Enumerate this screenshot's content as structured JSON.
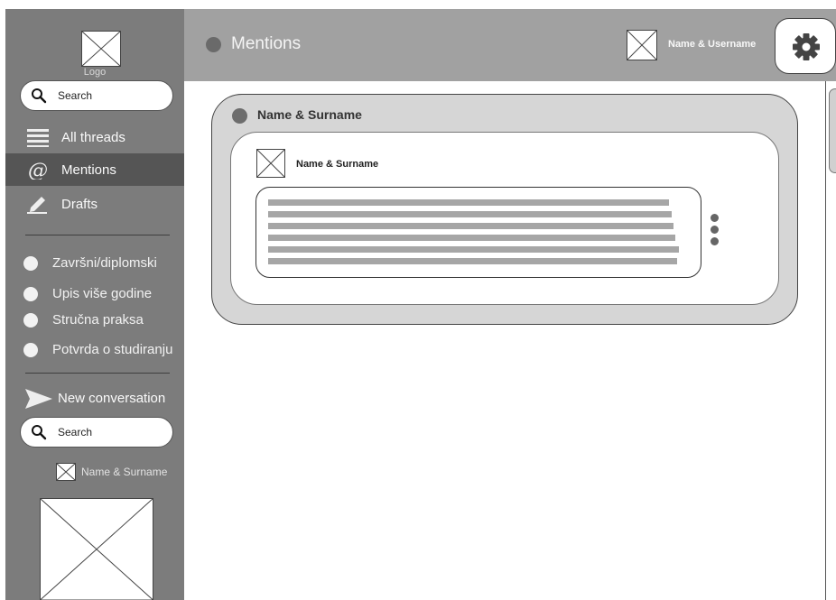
{
  "sidebar": {
    "logo_label": "Logo",
    "search_top": {
      "placeholder": "Search"
    },
    "nav": [
      {
        "label": "All threads",
        "icon": "list-icon"
      },
      {
        "label": "Mentions",
        "icon": "at-icon",
        "active": true
      },
      {
        "label": "Drafts",
        "icon": "pencil-icon"
      }
    ],
    "categories": [
      {
        "label": "Završni/diplomski"
      },
      {
        "label": "Upis više godine"
      },
      {
        "label": "Stručna praksa"
      },
      {
        "label": "Potvrda o studiranju"
      }
    ],
    "new_conversation_label": "New conversation",
    "search_bottom": {
      "placeholder": "Search"
    },
    "user_label": "Name & Surname"
  },
  "header": {
    "title": "Mentions",
    "user_label": "Name & Username",
    "settings_icon": "gear-icon"
  },
  "thread": {
    "name": "Name & Surname",
    "message": {
      "author": "Name & Surname",
      "more_icon": "vertical-dots-icon"
    }
  },
  "colors": {
    "sidebar_bg": "#7c7c7c",
    "header_bg": "#a1a1a1",
    "active_nav_bg": "#555555",
    "thread_bg": "#d6d6d6"
  }
}
